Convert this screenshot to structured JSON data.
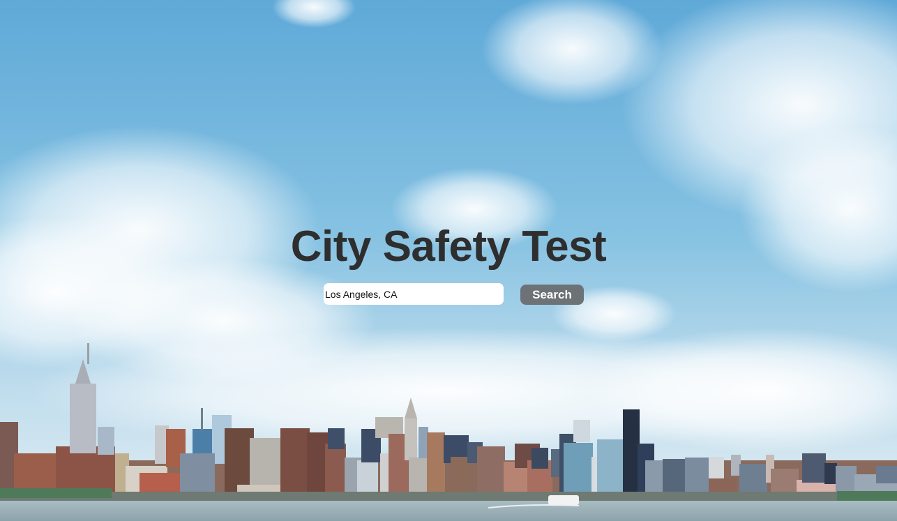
{
  "page": {
    "title": "City Safety Test"
  },
  "search": {
    "value": "Los Angeles, CA",
    "button_label": "Search"
  },
  "background": {
    "sky_top": "#6fb3dc",
    "sky_bottom": "#c9e2ee",
    "water": "#9fb4bd"
  }
}
